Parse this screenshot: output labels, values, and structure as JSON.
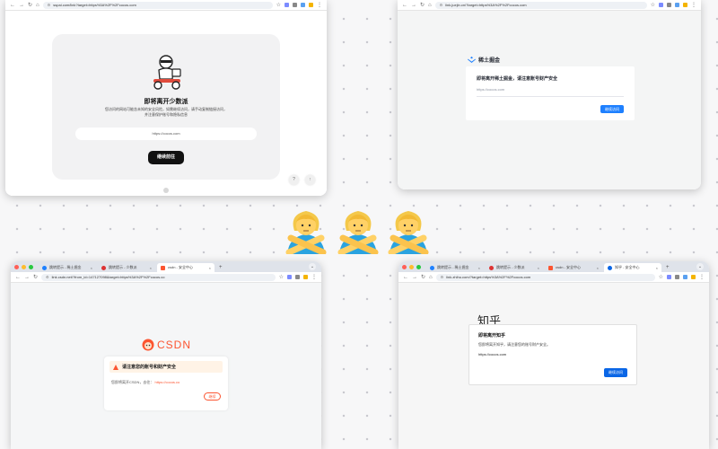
{
  "colors": {
    "page_bg": "#f7f7f8",
    "csdn_red": "#fc5531",
    "juejin_blue": "#1e80ff",
    "zhihu_blue": "#0a66e6"
  },
  "w1": {
    "url": "sspai.com/link?target=https%3A%2F%2Fcocos.com",
    "title": "即将离开少数派",
    "desc1": "您访问的网站可能含未知的安全风险，如需继续访问，请手动复制链接访问，",
    "desc2": "并注意保护账号和隐私信息",
    "target": "https://cocos.com",
    "button": "继续前往"
  },
  "w2": {
    "url": "link.juejin.cn/?target=https%3A%2F%2Fcocos.com",
    "logo": "稀土掘金",
    "title": "即将离开稀土掘金，请注意账号财产安全",
    "target": "https://cocos.com",
    "button": "继续访问"
  },
  "w3": {
    "tabs": [
      "跳转提示 - 稀土掘金",
      "跳转提示 - 少数派",
      "csdn - 安全中心"
    ],
    "url": "link.csdn.net/?from_id=147127098&target=https%3A%2F%2Fcocos.co",
    "logo": "CSDN",
    "title": "请注意您的账号和财产安全",
    "msg": "您即将离开CSDN，去往：",
    "link": "https://cocos.co",
    "button": "继续"
  },
  "w4": {
    "tabs": [
      "跳转提示 - 稀土掘金",
      "跳转提示 - 少数派",
      "csdn - 安全中心",
      "知乎 - 安全中心"
    ],
    "url": "link.zhihu.com/?target=https%3A%2F%2Fcocos.com",
    "logo": "知乎",
    "title": "即将离开知乎",
    "desc": "您即将离开知乎，请注意您的账号财产安全。",
    "target": "https://cocos.com",
    "button": "继续访问"
  },
  "emoji_icon": "person-gesturing-no-icon"
}
